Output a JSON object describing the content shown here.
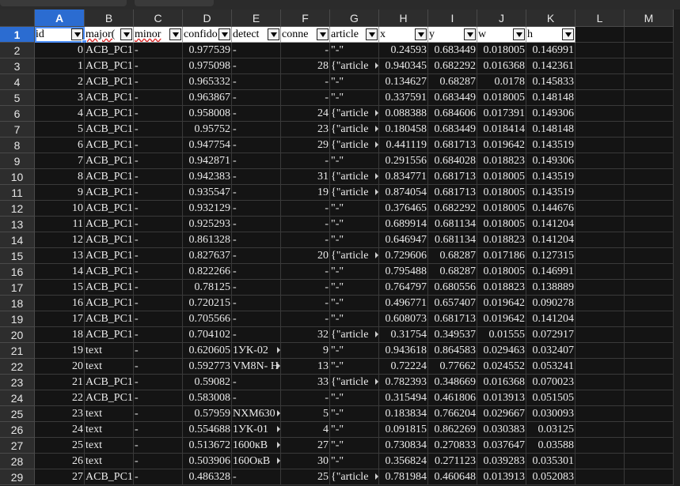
{
  "columns": [
    "A",
    "B",
    "C",
    "D",
    "E",
    "F",
    "G",
    "H",
    "I",
    "J",
    "K",
    "L",
    "M"
  ],
  "selected_column": "A",
  "selected_row": "1",
  "header_row": [
    "id",
    "major(",
    "minor",
    "confido",
    "detect",
    "conne",
    "article",
    "x",
    "y",
    "w",
    "h"
  ],
  "rows": [
    {
      "n": "2",
      "c": [
        "0",
        "ACB_PC1",
        "-",
        "0.977539",
        "-",
        "-",
        "\"-\"",
        "0.24593",
        "0.683449",
        "0.018005",
        "0.146991"
      ]
    },
    {
      "n": "3",
      "c": [
        "1",
        "ACB_PC1",
        "-",
        "0.975098",
        "-",
        "28",
        "{\"article",
        "0.940345",
        "0.682292",
        "0.016368",
        "0.142361"
      ]
    },
    {
      "n": "4",
      "c": [
        "2",
        "ACB_PC1",
        "-",
        "0.965332",
        "-",
        "-",
        "\"-\"",
        "0.134627",
        "0.68287",
        "0.0178",
        "0.145833"
      ]
    },
    {
      "n": "5",
      "c": [
        "3",
        "ACB_PC1",
        "-",
        "0.963867",
        "-",
        "-",
        "\"-\"",
        "0.337591",
        "0.683449",
        "0.018005",
        "0.148148"
      ]
    },
    {
      "n": "6",
      "c": [
        "4",
        "ACB_PC1",
        "-",
        "0.958008",
        "-",
        "24",
        "{\"article",
        "0.088388",
        "0.684606",
        "0.017391",
        "0.149306"
      ]
    },
    {
      "n": "7",
      "c": [
        "5",
        "ACB_PC1",
        "-",
        "0.95752",
        "-",
        "23",
        "{\"article",
        "0.180458",
        "0.683449",
        "0.018414",
        "0.148148"
      ]
    },
    {
      "n": "8",
      "c": [
        "6",
        "ACB_PC1",
        "-",
        "0.947754",
        "-",
        "29",
        "{\"article",
        "0.441119",
        "0.681713",
        "0.019642",
        "0.143519"
      ]
    },
    {
      "n": "9",
      "c": [
        "7",
        "ACB_PC1",
        "-",
        "0.942871",
        "-",
        "-",
        "\"-\"",
        "0.291556",
        "0.684028",
        "0.018823",
        "0.149306"
      ]
    },
    {
      "n": "10",
      "c": [
        "8",
        "ACB_PC1",
        "-",
        "0.942383",
        "-",
        "31",
        "{\"article",
        "0.834771",
        "0.681713",
        "0.018005",
        "0.143519"
      ]
    },
    {
      "n": "11",
      "c": [
        "9",
        "ACB_PC1",
        "-",
        "0.935547",
        "-",
        "19",
        "{\"article",
        "0.874054",
        "0.681713",
        "0.018005",
        "0.143519"
      ]
    },
    {
      "n": "12",
      "c": [
        "10",
        "ACB_PC1",
        "-",
        "0.932129",
        "-",
        "-",
        "\"-\"",
        "0.376465",
        "0.682292",
        "0.018005",
        "0.144676"
      ]
    },
    {
      "n": "13",
      "c": [
        "11",
        "ACB_PC1",
        "-",
        "0.925293",
        "-",
        "-",
        "\"-\"",
        "0.689914",
        "0.681134",
        "0.018005",
        "0.141204"
      ]
    },
    {
      "n": "14",
      "c": [
        "12",
        "ACB_PC1",
        "-",
        "0.861328",
        "-",
        "-",
        "\"-\"",
        "0.646947",
        "0.681134",
        "0.018823",
        "0.141204"
      ]
    },
    {
      "n": "15",
      "c": [
        "13",
        "ACB_PC1",
        "-",
        "0.827637",
        "-",
        "20",
        "{\"article",
        "0.729606",
        "0.68287",
        "0.017186",
        "0.127315"
      ]
    },
    {
      "n": "16",
      "c": [
        "14",
        "ACB_PC1",
        "-",
        "0.822266",
        "-",
        "-",
        "\"-\"",
        "0.795488",
        "0.68287",
        "0.018005",
        "0.146991"
      ]
    },
    {
      "n": "17",
      "c": [
        "15",
        "ACB_PC1",
        "-",
        "0.78125",
        "-",
        "-",
        "\"-\"",
        "0.764797",
        "0.680556",
        "0.018823",
        "0.138889"
      ]
    },
    {
      "n": "18",
      "c": [
        "16",
        "ACB_PC1",
        "-",
        "0.720215",
        "-",
        "-",
        "\"-\"",
        "0.496771",
        "0.657407",
        "0.019642",
        "0.090278"
      ]
    },
    {
      "n": "19",
      "c": [
        "17",
        "ACB_PC1",
        "-",
        "0.705566",
        "-",
        "-",
        "\"-\"",
        "0.608073",
        "0.681713",
        "0.019642",
        "0.141204"
      ]
    },
    {
      "n": "20",
      "c": [
        "18",
        "ACB_PC1",
        "-",
        "0.704102",
        "-",
        "32",
        "{\"article",
        "0.31754",
        "0.349537",
        "0.01555",
        "0.072917"
      ]
    },
    {
      "n": "21",
      "c": [
        "19",
        "text",
        "-",
        "0.620605",
        "1УК-02",
        "9",
        "\"-\"",
        "0.943618",
        "0.864583",
        "0.029463",
        "0.032407"
      ]
    },
    {
      "n": "22",
      "c": [
        "20",
        "text",
        "-",
        "0.592773",
        "VM8N- H",
        "13",
        "\"-\"",
        "0.72224",
        "0.77662",
        "0.024552",
        "0.053241"
      ]
    },
    {
      "n": "23",
      "c": [
        "21",
        "ACB_PC1",
        "-",
        "0.59082",
        "-",
        "33",
        "{\"article",
        "0.782393",
        "0.348669",
        "0.016368",
        "0.070023"
      ]
    },
    {
      "n": "24",
      "c": [
        "22",
        "ACB_PC1",
        "-",
        "0.583008",
        "-",
        "-",
        "\"-\"",
        "0.315494",
        "0.461806",
        "0.013913",
        "0.051505"
      ]
    },
    {
      "n": "25",
      "c": [
        "23",
        "text",
        "-",
        "0.57959",
        "NXM630",
        "5",
        "\"-\"",
        "0.183834",
        "0.766204",
        "0.029667",
        "0.030093"
      ]
    },
    {
      "n": "26",
      "c": [
        "24",
        "text",
        "-",
        "0.554688",
        "1УК-01",
        "4",
        "\"-\"",
        "0.091815",
        "0.862269",
        "0.030383",
        "0.03125"
      ]
    },
    {
      "n": "27",
      "c": [
        "25",
        "text",
        "-",
        "0.513672",
        "1600кВ",
        "27",
        "\"-\"",
        "0.730834",
        "0.270833",
        "0.037647",
        "0.03588"
      ]
    },
    {
      "n": "28",
      "c": [
        "26",
        "text",
        "-",
        "0.503906",
        "160ОкВ",
        "30",
        "\"-\"",
        "0.356824",
        "0.271123",
        "0.039283",
        "0.035301"
      ]
    },
    {
      "n": "29",
      "c": [
        "27",
        "ACB_PC1",
        "-",
        "0.486328",
        "-",
        "25",
        "{\"article",
        "0.781984",
        "0.460648",
        "0.013913",
        "0.052083"
      ]
    }
  ]
}
